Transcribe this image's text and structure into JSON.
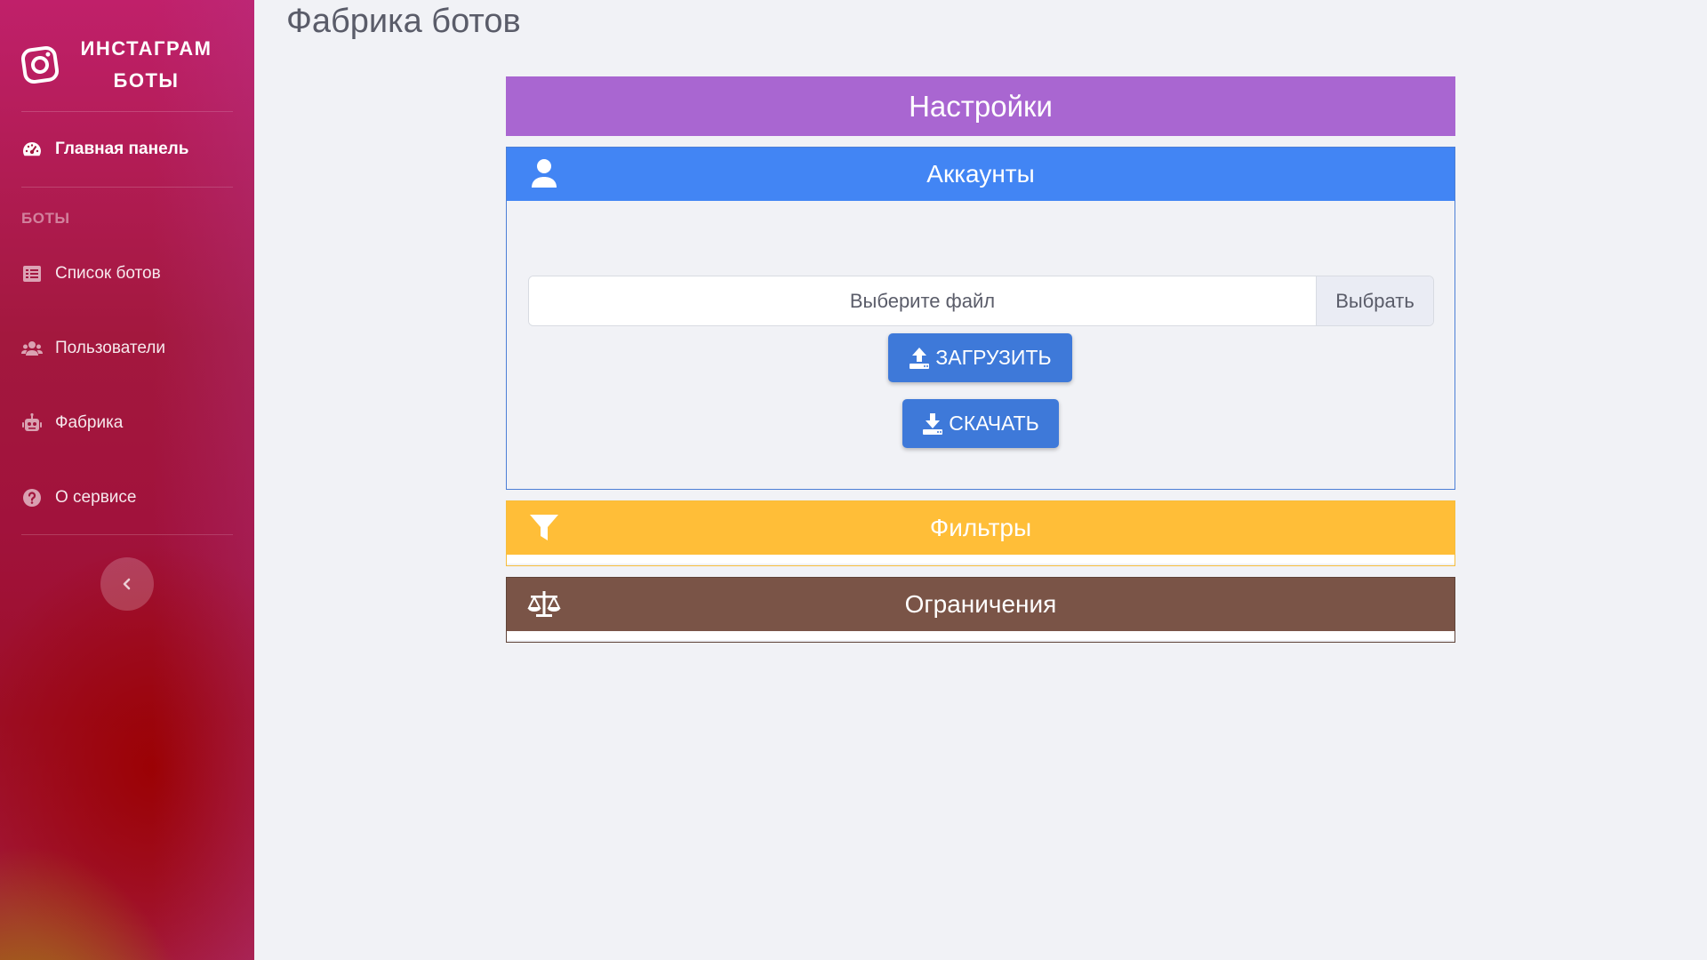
{
  "sidebar": {
    "brand": {
      "line1": "ИНСТАГРАМ",
      "line2": "БОТЫ",
      "icon": "instagram-icon"
    },
    "dashboard": {
      "label": "Главная панель",
      "icon": "tachometer-icon"
    },
    "section_heading": "БОТЫ",
    "items": [
      {
        "label": "Список ботов",
        "icon": "list-icon"
      },
      {
        "label": "Пользователи",
        "icon": "users-icon"
      },
      {
        "label": "Фабрика",
        "icon": "robot-icon"
      },
      {
        "label": "О сервисе",
        "icon": "question-circle-icon"
      }
    ],
    "toggle_icon": "chevron-left-icon"
  },
  "main": {
    "page_title": "Фабрика ботов",
    "settings_title": "Настройки",
    "accounts": {
      "title": "Аккаунты",
      "icon": "user-icon",
      "file_placeholder": "Выберите файл",
      "choose_label": "Выбрать",
      "upload_label": "ЗАГРУЗИТЬ",
      "download_label": "СКАЧАТЬ"
    },
    "filters": {
      "title": "Фильтры",
      "icon": "filter-icon"
    },
    "limits": {
      "title": "Ограничения",
      "icon": "balance-scale-icon"
    }
  },
  "colors": {
    "settings": "#a966d1",
    "accounts": "#4285f4",
    "filters": "#ffbe38",
    "limits": "#7a5447",
    "button": "#3e79d9"
  }
}
